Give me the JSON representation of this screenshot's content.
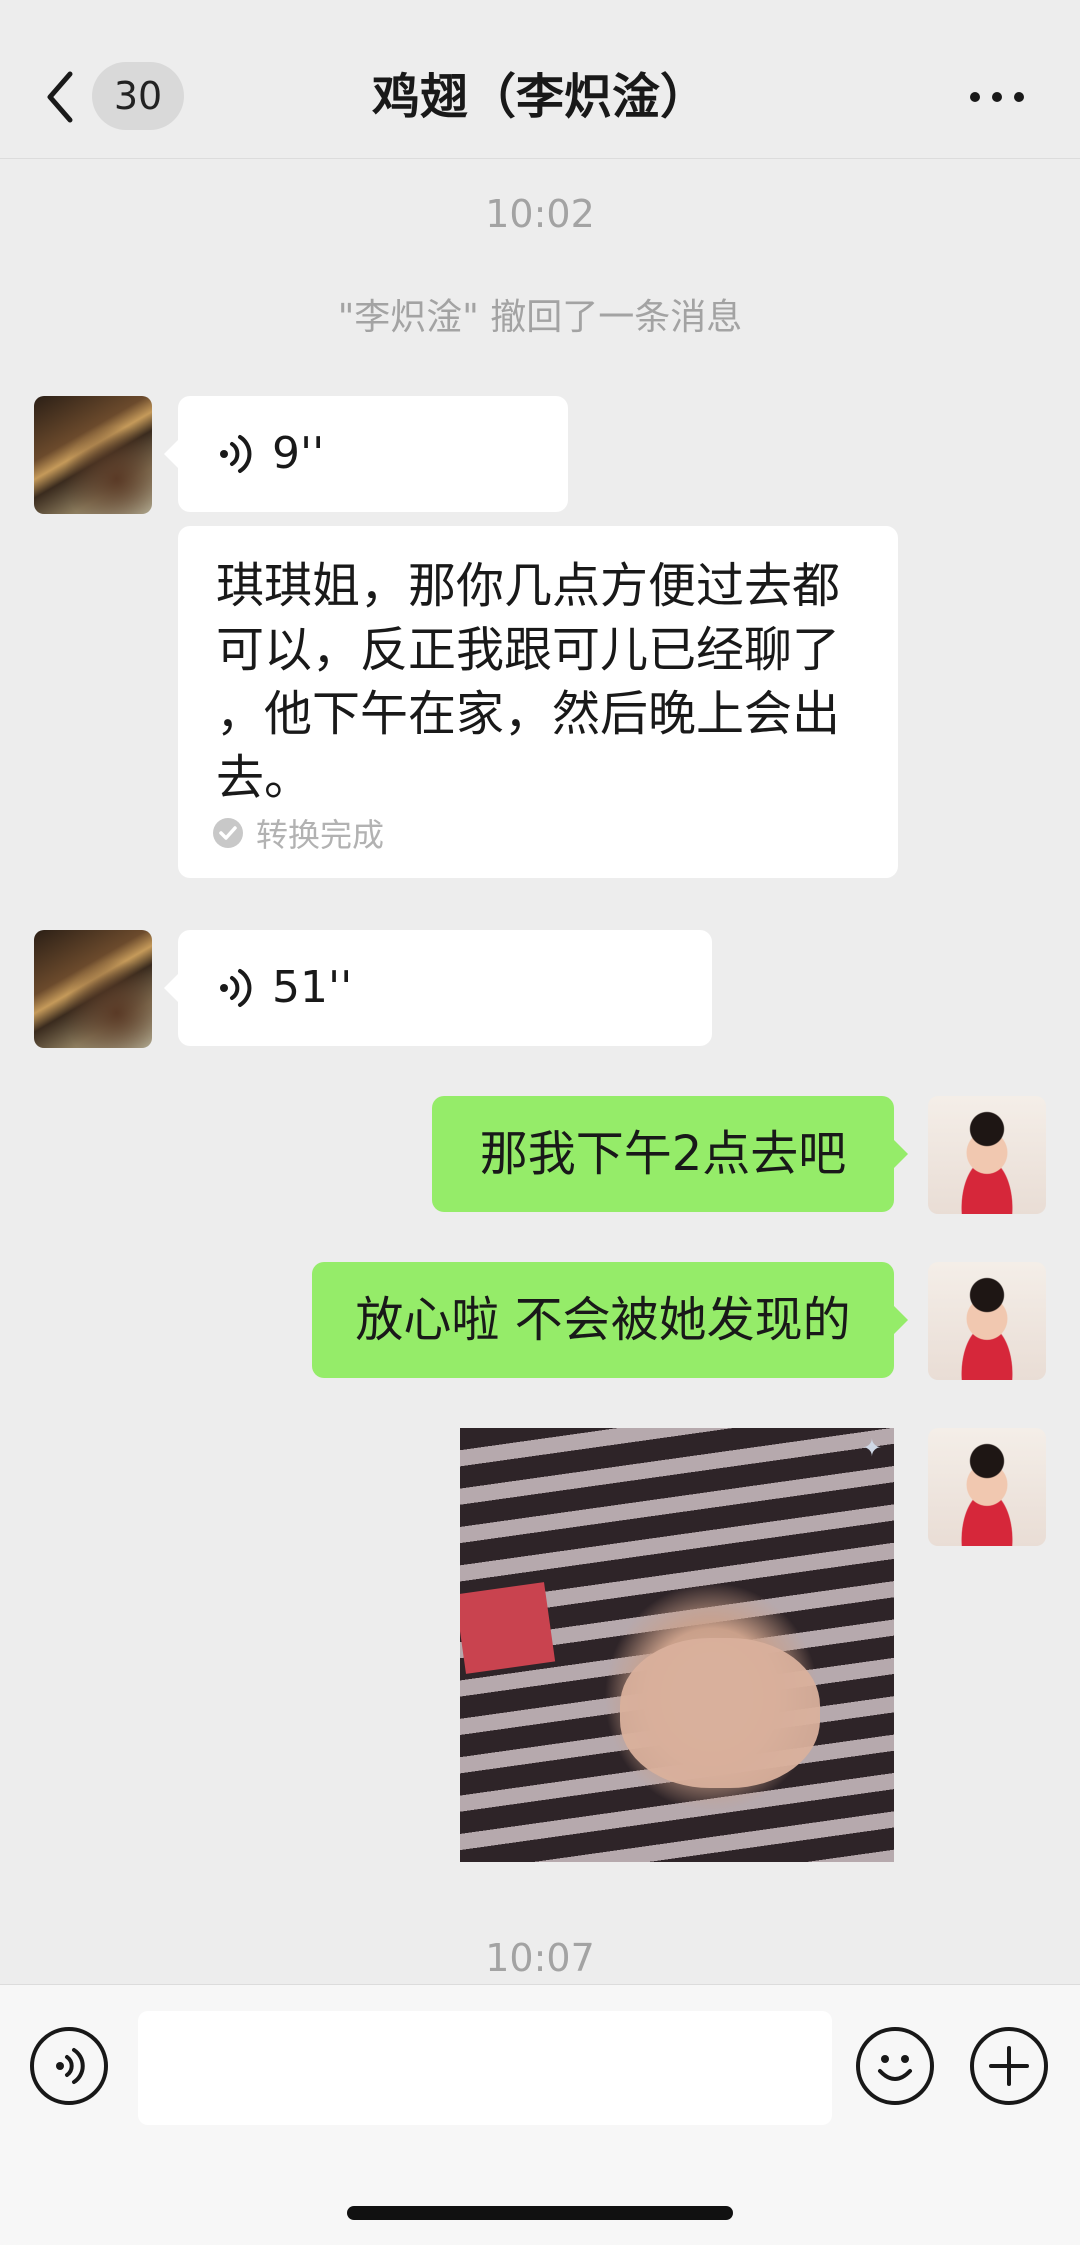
{
  "header": {
    "title": "鸡翅（李炽淦）",
    "unread_count": "30",
    "back_icon": "chevron-left-icon",
    "more_icon": "more-dots-icon"
  },
  "timestamps": [
    "10:02",
    "10:07"
  ],
  "system_message": "\"李炽淦\" 撤回了一条消息",
  "messages": [
    {
      "side": "left",
      "type": "voice",
      "duration": "9''",
      "icon": "voice-wave-icon"
    },
    {
      "side": "left",
      "type": "transcript",
      "text": "琪琪姐，那你几点方便过去都\n可以，反正我跟可儿已经聊了\n，他下午在家，然后晚上会出\n去。",
      "status": "转换完成"
    },
    {
      "side": "left",
      "type": "voice",
      "duration": "51''",
      "icon": "voice-wave-icon"
    },
    {
      "side": "right",
      "type": "text",
      "text": "那我下午2点去吧"
    },
    {
      "side": "right",
      "type": "text",
      "text": "放心啦 不会被她发现的"
    },
    {
      "side": "right",
      "type": "image",
      "description_icon": "photo-thumbnail"
    }
  ],
  "input_bar": {
    "voice_icon": "voice-input-icon",
    "emoji_icon": "emoji-icon",
    "plus_icon": "plus-icon",
    "placeholder": ""
  },
  "colors": {
    "background": "#ededed",
    "sent_bubble": "#95ec69",
    "received_bubble": "#ffffff",
    "muted_text": "#a3a3a3"
  }
}
